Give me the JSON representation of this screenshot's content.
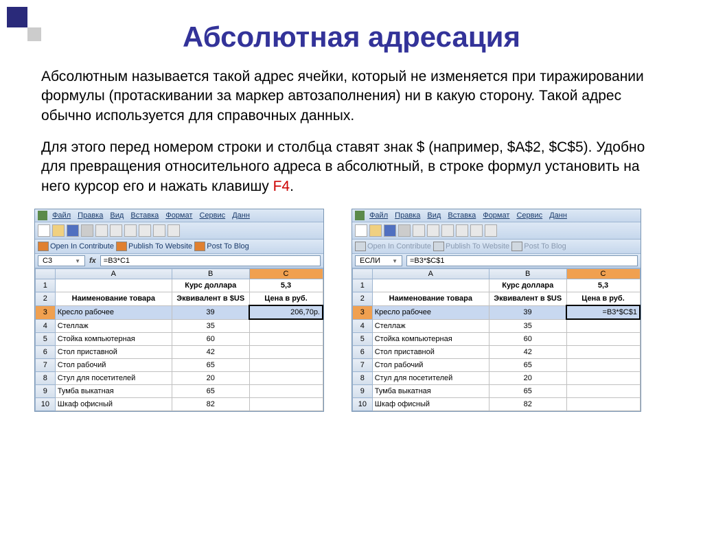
{
  "title": "Абсолютная адресация",
  "para1": "Абсолютным называется такой адрес ячейки, который не изменяется при тиражировании формулы (протаскивании за маркер автозаполнения) ни в какую сторону. Такой адрес обычно используется для справочных данных.",
  "para2a": "Для этого перед номером строки и столбца ставят знак $ (например, $A$2, $C$5). Удобно для превращения относительного адреса в абсолютный, в строке формул установить на него курсор его и нажать клавишу  ",
  "para2b": "F4",
  "para2c": ".",
  "menu": {
    "file": "Файл",
    "edit": "Правка",
    "view": "Вид",
    "insert": "Вставка",
    "format": "Формат",
    "tools": "Сервис",
    "data": "Данн"
  },
  "contribute": {
    "open": "Open In Contribute",
    "publish": "Publish To Website",
    "post": "Post To Blog"
  },
  "left": {
    "namebox": "C3",
    "formula": "=B3*C1",
    "headers": {
      "name": "Наименование товара",
      "equiv": "Эквивалент в $US",
      "price": "Цена в руб.",
      "rate": "Курс доллара",
      "rateval": "5,3"
    },
    "selrow": 3,
    "selcol": "C",
    "rows": [
      {
        "n": 3,
        "a": "Кресло рабочее",
        "b": "39",
        "c": "206,70р."
      },
      {
        "n": 4,
        "a": "Стеллаж",
        "b": "35",
        "c": ""
      },
      {
        "n": 5,
        "a": "Стойка компьютерная",
        "b": "60",
        "c": ""
      },
      {
        "n": 6,
        "a": "Стол приставной",
        "b": "42",
        "c": ""
      },
      {
        "n": 7,
        "a": "Стол рабочий",
        "b": "65",
        "c": ""
      },
      {
        "n": 8,
        "a": "Стул для посетителей",
        "b": "20",
        "c": ""
      },
      {
        "n": 9,
        "a": "Тумба выкатная",
        "b": "65",
        "c": ""
      },
      {
        "n": 10,
        "a": "Шкаф офисный",
        "b": "82",
        "c": ""
      }
    ]
  },
  "right": {
    "namebox": "ЕСЛИ",
    "formula": "=B3*$C$1",
    "headers": {
      "name": "Наименование товара",
      "equiv": "Эквивалент в $US",
      "price": "Цена в руб.",
      "rate": "Курс доллара",
      "rateval": "5,3"
    },
    "selrow": 3,
    "selcol": "C",
    "rows": [
      {
        "n": 3,
        "a": "Кресло рабочее",
        "b": "39",
        "c": "=B3*$C$1"
      },
      {
        "n": 4,
        "a": "Стеллаж",
        "b": "35",
        "c": ""
      },
      {
        "n": 5,
        "a": "Стойка компьютерная",
        "b": "60",
        "c": ""
      },
      {
        "n": 6,
        "a": "Стол приставной",
        "b": "42",
        "c": ""
      },
      {
        "n": 7,
        "a": "Стол рабочий",
        "b": "65",
        "c": ""
      },
      {
        "n": 8,
        "a": "Стул для посетителей",
        "b": "20",
        "c": ""
      },
      {
        "n": 9,
        "a": "Тумба выкатная",
        "b": "65",
        "c": ""
      },
      {
        "n": 10,
        "a": "Шкаф офисный",
        "b": "82",
        "c": ""
      }
    ]
  }
}
